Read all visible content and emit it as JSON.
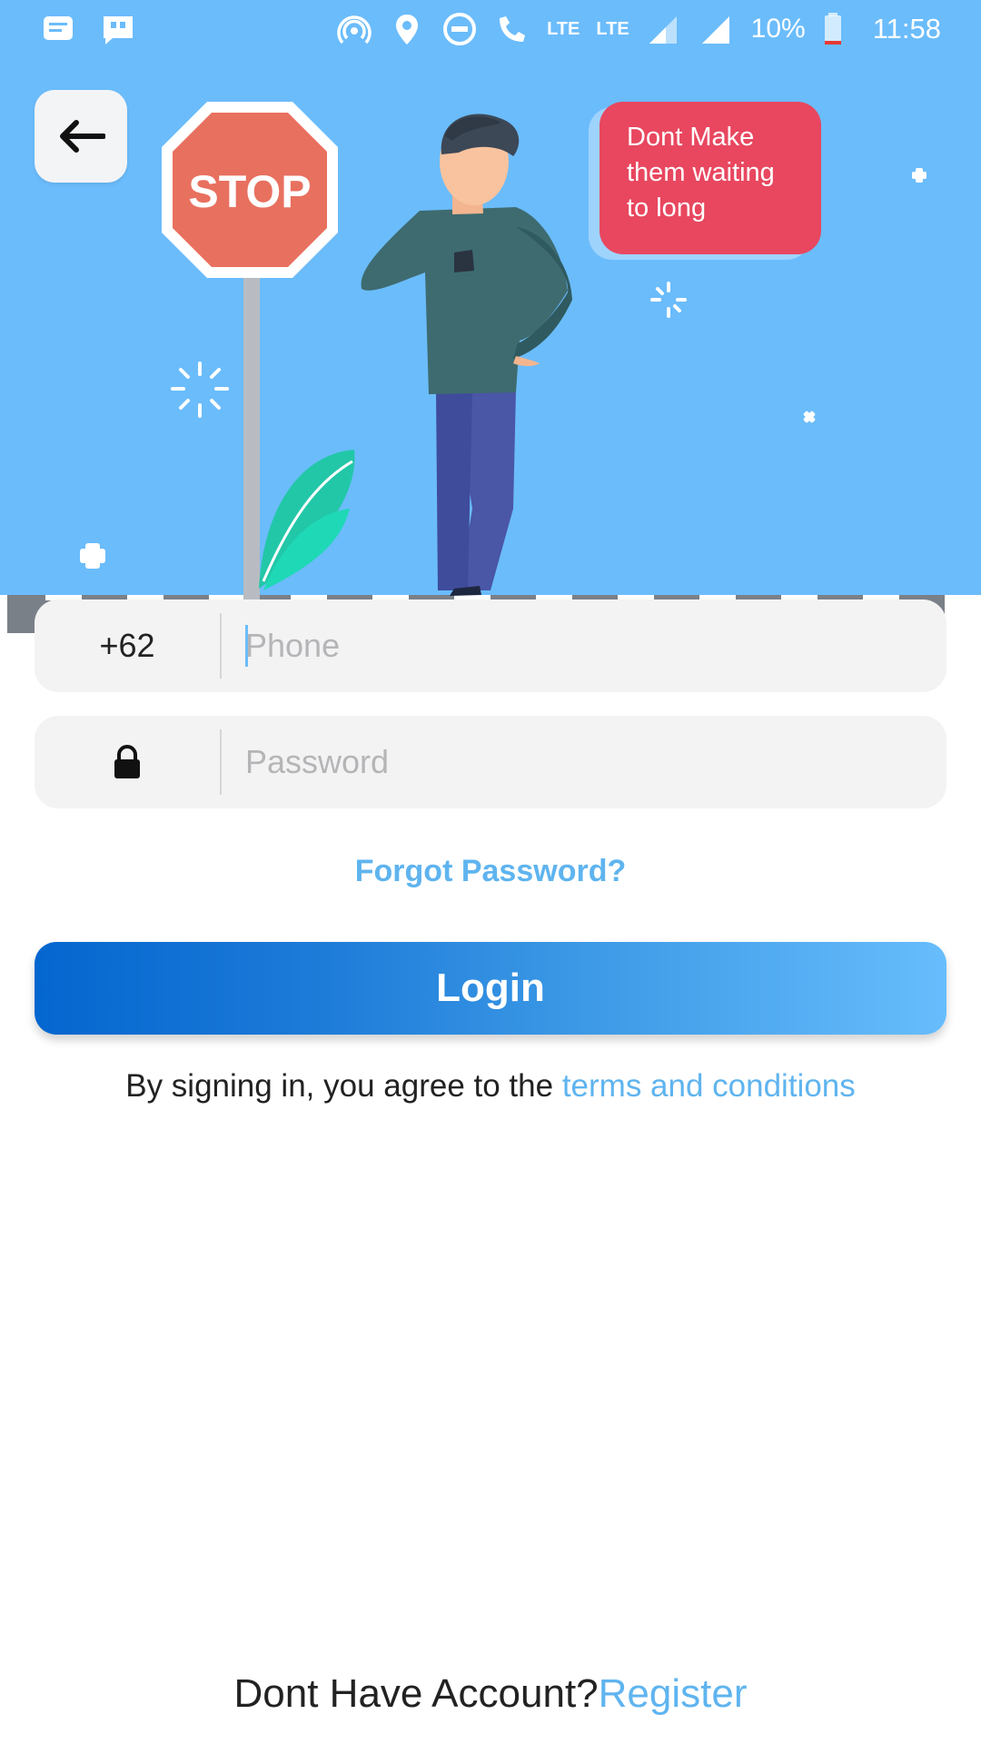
{
  "status_bar": {
    "lte_small": "LTE",
    "lte": "LTE",
    "battery": "10%",
    "time": "11:58"
  },
  "hero": {
    "stop_sign_text": "STOP",
    "speech_bubble_lines": [
      "Dont Make",
      "them waiting",
      "to long"
    ],
    "colors": {
      "sky": "#6bbcfb",
      "stop": "#e8705f",
      "bubble": "#e8475f"
    }
  },
  "form": {
    "country_code": "+62",
    "phone_placeholder": "Phone",
    "password_placeholder": "Password",
    "forgot_label": "Forgot Password?",
    "login_label": "Login",
    "terms_prefix": "By signing in, you agree to the ",
    "terms_link": "terms and conditions"
  },
  "footer": {
    "no_account": "Dont Have Account?",
    "register": "Register"
  },
  "icons": [
    "message-icon",
    "quote-icon",
    "hotspot-icon",
    "location-icon",
    "dnd-icon",
    "wifi-call-icon",
    "signal-icon",
    "battery-icon",
    "back-arrow-icon",
    "lock-icon"
  ],
  "accent": "#5fb4ef"
}
